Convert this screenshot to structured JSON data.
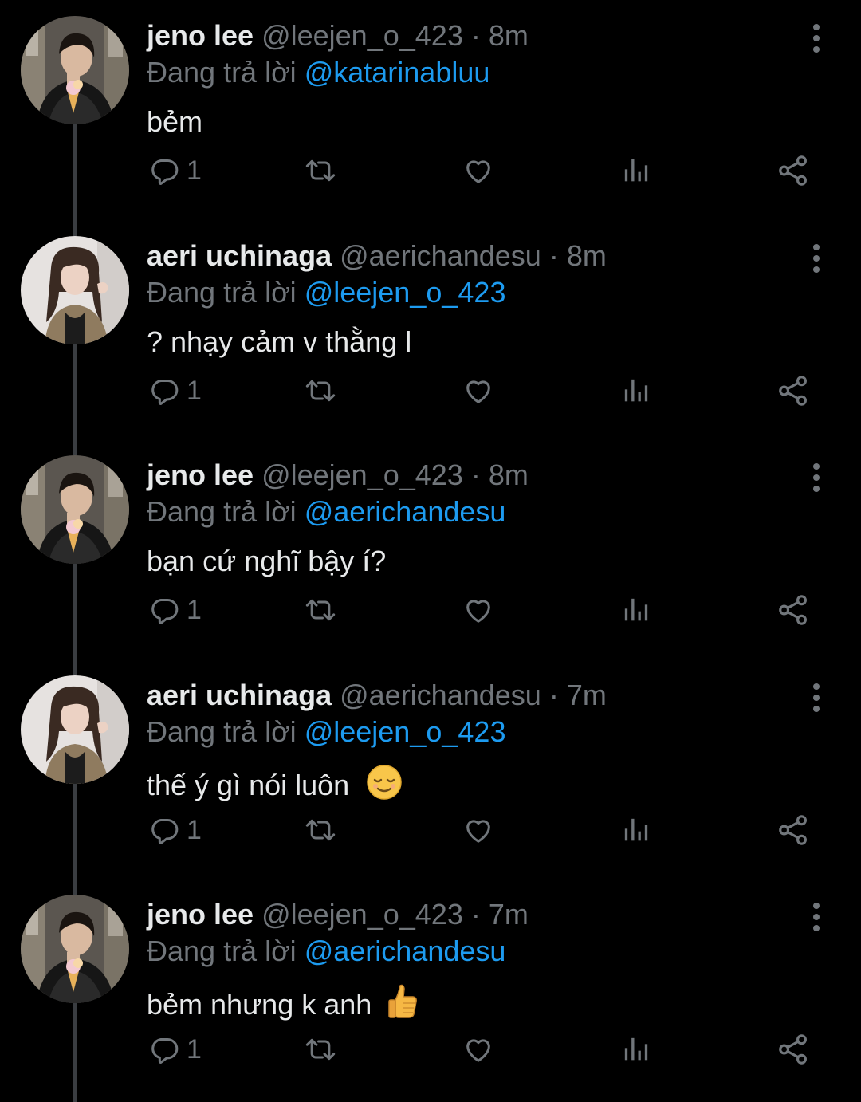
{
  "colors": {
    "background": "#000000",
    "text_primary": "#e7e9ea",
    "text_secondary": "#71767b",
    "mention": "#1d9bf0",
    "thread_line": "#3a3d41"
  },
  "reply_prefix": "Đang trả lời",
  "tweets": [
    {
      "display_name": "jeno lee",
      "handle": "@leejen_o_423",
      "separator": "·",
      "time": "8m",
      "reply_to": "@katarinabluu",
      "text": "bẻm",
      "emoji": "",
      "reply_count": "1",
      "avatar": "jeno-avatar"
    },
    {
      "display_name": "aeri uchinaga",
      "handle": "@aerichandesu",
      "separator": "·",
      "time": "8m",
      "reply_to": "@leejen_o_423",
      "text": "? nhạy cảm v thằng l",
      "emoji": "",
      "reply_count": "1",
      "avatar": "aeri-avatar"
    },
    {
      "display_name": "jeno lee",
      "handle": "@leejen_o_423",
      "separator": "·",
      "time": "8m",
      "reply_to": "@aerichandesu",
      "text": "bạn cứ nghĩ bậy í?",
      "emoji": "",
      "reply_count": "1",
      "avatar": "jeno-avatar"
    },
    {
      "display_name": "aeri uchinaga",
      "handle": "@aerichandesu",
      "separator": "·",
      "time": "7m",
      "reply_to": "@leejen_o_423",
      "text": "thế ý gì nói luôn",
      "emoji": "relieved-face-emoji",
      "reply_count": "1",
      "avatar": "aeri-avatar"
    },
    {
      "display_name": "jeno lee",
      "handle": "@leejen_o_423",
      "separator": "·",
      "time": "7m",
      "reply_to": "@aerichandesu",
      "text": "bẻm nhưng k anh",
      "emoji": "thumbs-up-emoji",
      "reply_count": "1",
      "avatar": "jeno-avatar"
    }
  ],
  "icons": {
    "reply": "reply-icon",
    "retweet": "retweet-icon",
    "like": "heart-icon",
    "views": "views-icon",
    "share": "share-icon",
    "more": "more-vertical-icon"
  }
}
